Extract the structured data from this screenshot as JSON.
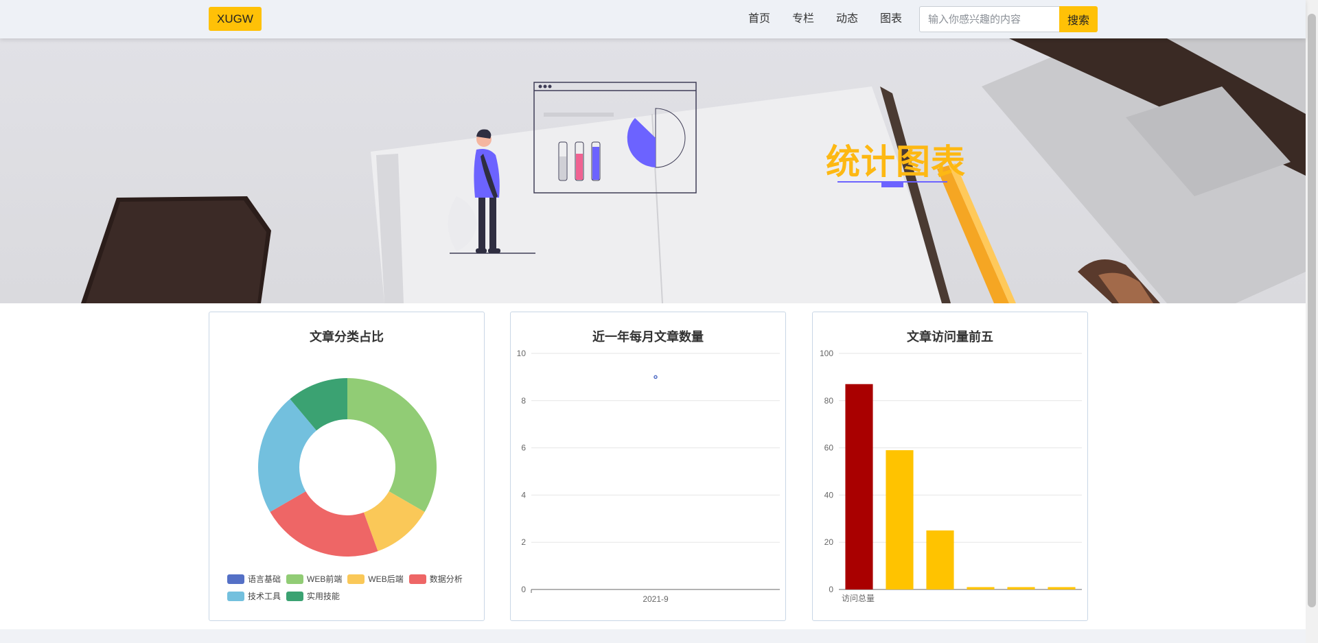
{
  "nav": {
    "brand": "XUGW",
    "links": [
      "首页",
      "专栏",
      "动态",
      "图表"
    ],
    "search_placeholder": "输入你感兴趣的内容",
    "search_button": "搜索"
  },
  "hero": {
    "title": "统计图表"
  },
  "charts": {
    "pie_title": "文章分类占比",
    "line_title": "近一年每月文章数量",
    "bar_title": "文章访问量前五"
  },
  "chart_data": [
    {
      "type": "pie",
      "title": "文章分类占比",
      "categories": [
        "语言基础",
        "WEB前端",
        "WEB后端",
        "数据分析",
        "技术工具",
        "实用技能"
      ],
      "values": [
        0,
        3,
        1,
        2,
        2,
        1
      ],
      "colors": [
        "#5470c6",
        "#91cc75",
        "#fac858",
        "#ee6666",
        "#73c0de",
        "#3ba272"
      ],
      "legend_position": "bottom"
    },
    {
      "type": "line",
      "title": "近一年每月文章数量",
      "x": [
        "2021-9"
      ],
      "values": [
        9
      ],
      "ylim": [
        0,
        10
      ],
      "yticks": [
        0,
        2,
        4,
        6,
        8,
        10
      ],
      "grid": true
    },
    {
      "type": "bar",
      "title": "文章访问量前五",
      "categories": [
        "访问总量",
        "",
        "",
        "",
        "",
        ""
      ],
      "values": [
        87,
        59,
        25,
        1,
        1,
        1
      ],
      "colors": [
        "#a90000",
        "#ffc300",
        "#ffc300",
        "#ffc300",
        "#ffc300",
        "#ffc300"
      ],
      "ylim": [
        0,
        100
      ],
      "yticks": [
        0,
        20,
        40,
        60,
        80,
        100
      ],
      "grid": true
    }
  ]
}
